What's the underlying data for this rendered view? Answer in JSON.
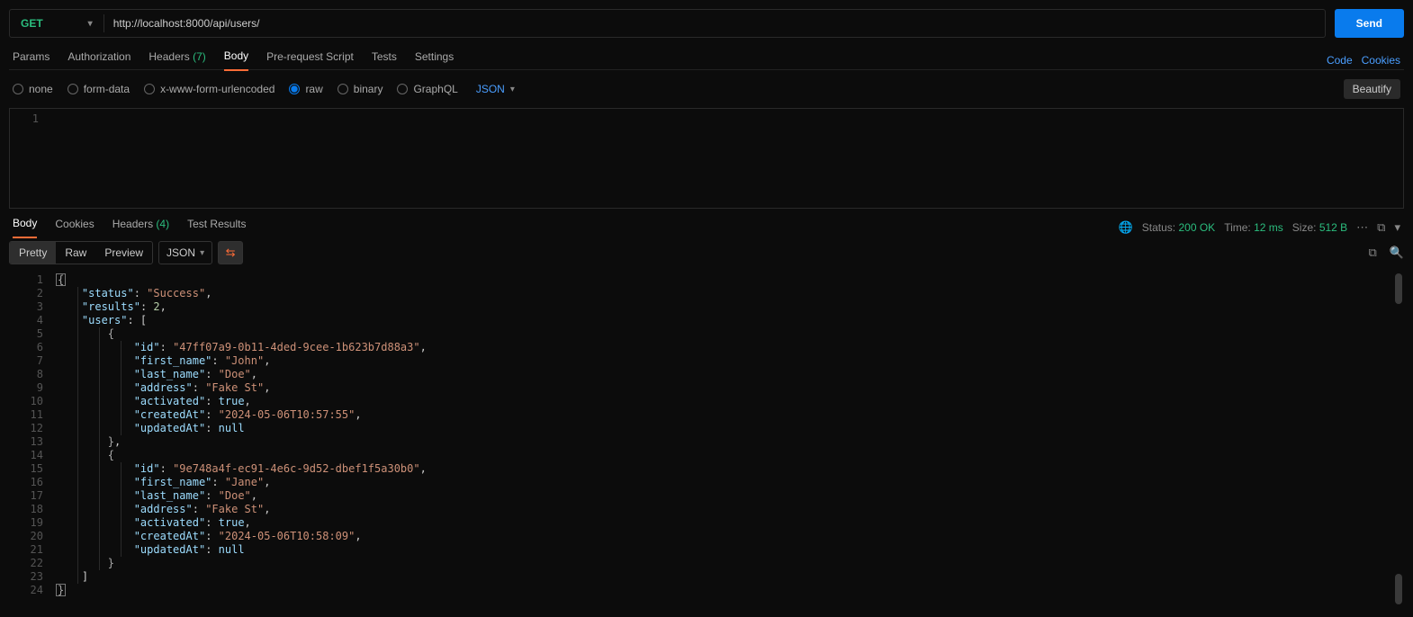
{
  "request": {
    "method": "GET",
    "url": "http://localhost:8000/api/users/",
    "send_label": "Send"
  },
  "request_tabs": {
    "params": "Params",
    "authorization": "Authorization",
    "headers_label": "Headers",
    "headers_count": "(7)",
    "body": "Body",
    "prerequest": "Pre-request Script",
    "tests": "Tests",
    "settings": "Settings",
    "code": "Code",
    "cookies": "Cookies"
  },
  "body_types": {
    "none": "none",
    "formdata": "form-data",
    "xwww": "x-www-form-urlencoded",
    "raw": "raw",
    "binary": "binary",
    "graphql": "GraphQL",
    "format": "JSON",
    "beautify": "Beautify"
  },
  "request_editor": {
    "line1_no": "1"
  },
  "response_tabs": {
    "body": "Body",
    "cookies": "Cookies",
    "headers_label": "Headers",
    "headers_count": "(4)",
    "test_results": "Test Results"
  },
  "response_meta": {
    "status_label": "Status:",
    "status_value": "200 OK",
    "time_label": "Time:",
    "time_value": "12 ms",
    "size_label": "Size:",
    "size_value": "512 B"
  },
  "response_toolbar": {
    "pretty": "Pretty",
    "raw": "Raw",
    "preview": "Preview",
    "json": "JSON"
  },
  "response_body": {
    "status": "Success",
    "results": 2,
    "users": [
      {
        "id": "47ff07a9-0b11-4ded-9cee-1b623b7d88a3",
        "first_name": "John",
        "last_name": "Doe",
        "address": "Fake St",
        "activated": true,
        "createdAt": "2024-05-06T10:57:55",
        "updatedAt": null
      },
      {
        "id": "9e748a4f-ec91-4e6c-9d52-dbef1f5a30b0",
        "first_name": "Jane",
        "last_name": "Doe",
        "address": "Fake St",
        "activated": true,
        "createdAt": "2024-05-06T10:58:09",
        "updatedAt": null
      }
    ]
  },
  "response_lines": [
    "1",
    "2",
    "3",
    "4",
    "5",
    "6",
    "7",
    "8",
    "9",
    "10",
    "11",
    "12",
    "13",
    "14",
    "15",
    "16",
    "17",
    "18",
    "19",
    "20",
    "21",
    "22",
    "23",
    "24"
  ]
}
